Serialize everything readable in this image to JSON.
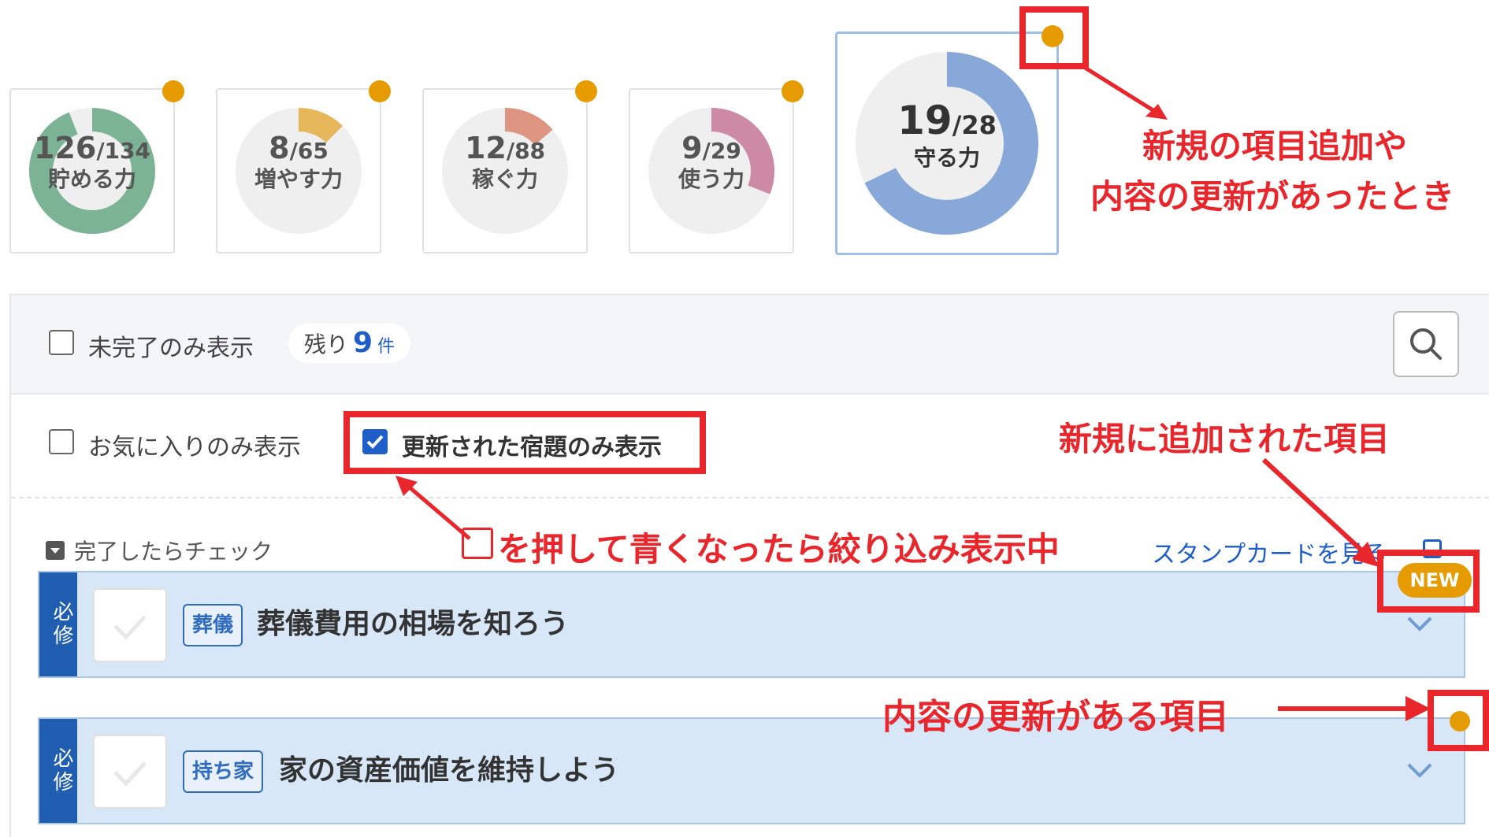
{
  "gauges": [
    {
      "current": 126,
      "total": 134,
      "label": "貯める力",
      "color": "#7db395"
    },
    {
      "current": 8,
      "total": 65,
      "label": "増やす力",
      "color": "#e5b65a"
    },
    {
      "current": 12,
      "total": 88,
      "label": "稼ぐ力",
      "color": "#dd9582"
    },
    {
      "current": 9,
      "total": 29,
      "label": "使う力",
      "color": "#cc8aa4"
    },
    {
      "current": 19,
      "total": 28,
      "label": "守る力",
      "color": "#87a8d8",
      "selected": true
    }
  ],
  "filters": {
    "incomplete_only": "未完了のみ表示",
    "remaining_prefix": "残り",
    "remaining_count": "9",
    "remaining_unit": "件",
    "favorites_only": "お気に入りのみ表示",
    "updated_only": "更新された宿題のみ表示"
  },
  "section": {
    "heading": "完了したらチェック",
    "stamp_link": "スタンプカードを見る"
  },
  "items": [
    {
      "badge": "必修",
      "category": "葬儀",
      "title": "葬儀費用の相場を知ろう",
      "new": "NEW"
    },
    {
      "badge": "必修",
      "category": "持ち家",
      "title": "家の資産価値を維持しよう"
    }
  ],
  "annotations": {
    "top_line1": "新規の項目追加や",
    "top_line2": "内容の更新があったとき",
    "new_item": "新規に追加された項目",
    "filter_hint": "を押して青くなったら絞り込み表示中",
    "updated_item": "内容の更新がある項目"
  },
  "colors": {
    "accent": "#1f5ec8",
    "dot": "#e69b00",
    "annotation": "#e8262b"
  }
}
